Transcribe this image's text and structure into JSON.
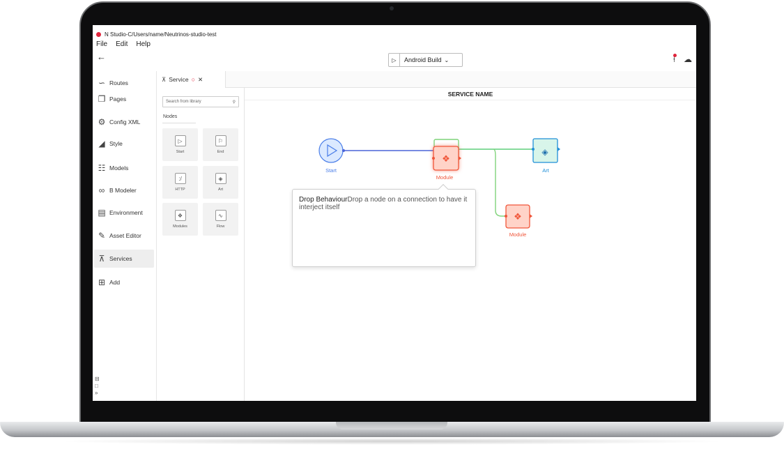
{
  "window": {
    "title": "N Studio-C/Users/name/Neutrinos-studio-test"
  },
  "menu": [
    "File",
    "Edit",
    "Help"
  ],
  "toolbar": {
    "build_label": "Android Build"
  },
  "sidebar": {
    "items": [
      {
        "label": "Routes",
        "icon": "route-icon"
      },
      {
        "label": "Pages",
        "icon": "pages-icon"
      },
      {
        "label": "Config XML",
        "icon": "gear-icon"
      },
      {
        "label": "Style",
        "icon": "paint-bucket-icon"
      },
      {
        "label": "Models",
        "icon": "sitemap-icon"
      },
      {
        "label": "B Modeler",
        "icon": "nodes-icon"
      },
      {
        "label": "Environment",
        "icon": "server-icon"
      },
      {
        "label": "Asset Editor",
        "icon": "folder-edit-icon"
      },
      {
        "label": "Services",
        "icon": "fork-icon",
        "active": true
      },
      {
        "label": "Add",
        "icon": "add-page-icon"
      }
    ]
  },
  "tab": {
    "label": "Service"
  },
  "panel": {
    "search_placeholder": "Search from library",
    "section_label": "Nodes",
    "nodes": [
      {
        "label": "Start",
        "icon": "play-icon"
      },
      {
        "label": "End",
        "icon": "flag-icon"
      },
      {
        "label": "HTTP",
        "icon": "http-icon"
      },
      {
        "label": "Art",
        "icon": "cube-icon"
      },
      {
        "label": "Modules",
        "icon": "modules-icon"
      },
      {
        "label": "Flow",
        "icon": "flow-icon"
      }
    ]
  },
  "canvas": {
    "header": "SERVICE NAME",
    "nodes": [
      {
        "label": "Start",
        "color": "#4a7ee8"
      },
      {
        "label": "Module",
        "color": "#f0563a"
      },
      {
        "label": "Art",
        "color": "#1f8fd8"
      },
      {
        "label": "Module",
        "color": "#f0563a"
      }
    ],
    "tooltip": {
      "title": "Drop Behaviour",
      "text": "Drop a node on a connection to have it interject itself"
    }
  }
}
